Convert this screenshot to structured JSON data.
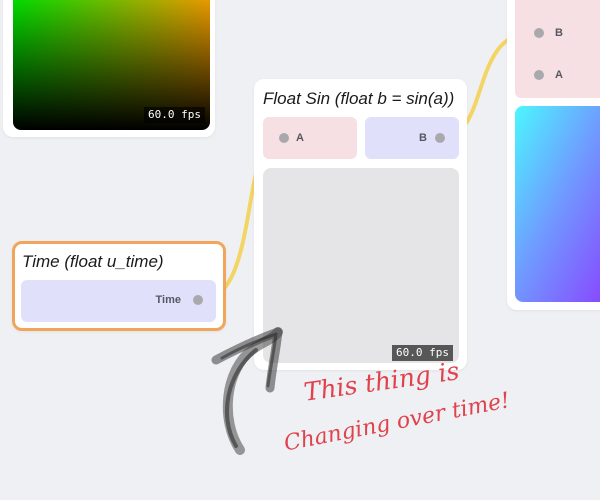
{
  "colors": {
    "canvas_bg": "#eff0f4",
    "connection_wire": "#f3d566",
    "selected_node_border": "#f0a55a",
    "input_port_bg": "#f6e0e3",
    "output_port_bg": "#e0e0fb",
    "annotation_ink": "#e0414a"
  },
  "color_preview_node": {
    "fps": "60.0 fps"
  },
  "float_sin_node": {
    "title": "Float Sin (float b = sin(a))",
    "input_label": "A",
    "output_label": "B",
    "fps": "60.0 fps"
  },
  "time_node": {
    "title": "Time (float u_time)",
    "output_label": "Time",
    "selected": true
  },
  "right_node": {
    "port_b_label": "B",
    "port_a_label": "A"
  },
  "annotation": {
    "line1": "This thing is",
    "line2": "Changing over time!",
    "arrow_icon": "hand-drawn-arrow-icon"
  }
}
